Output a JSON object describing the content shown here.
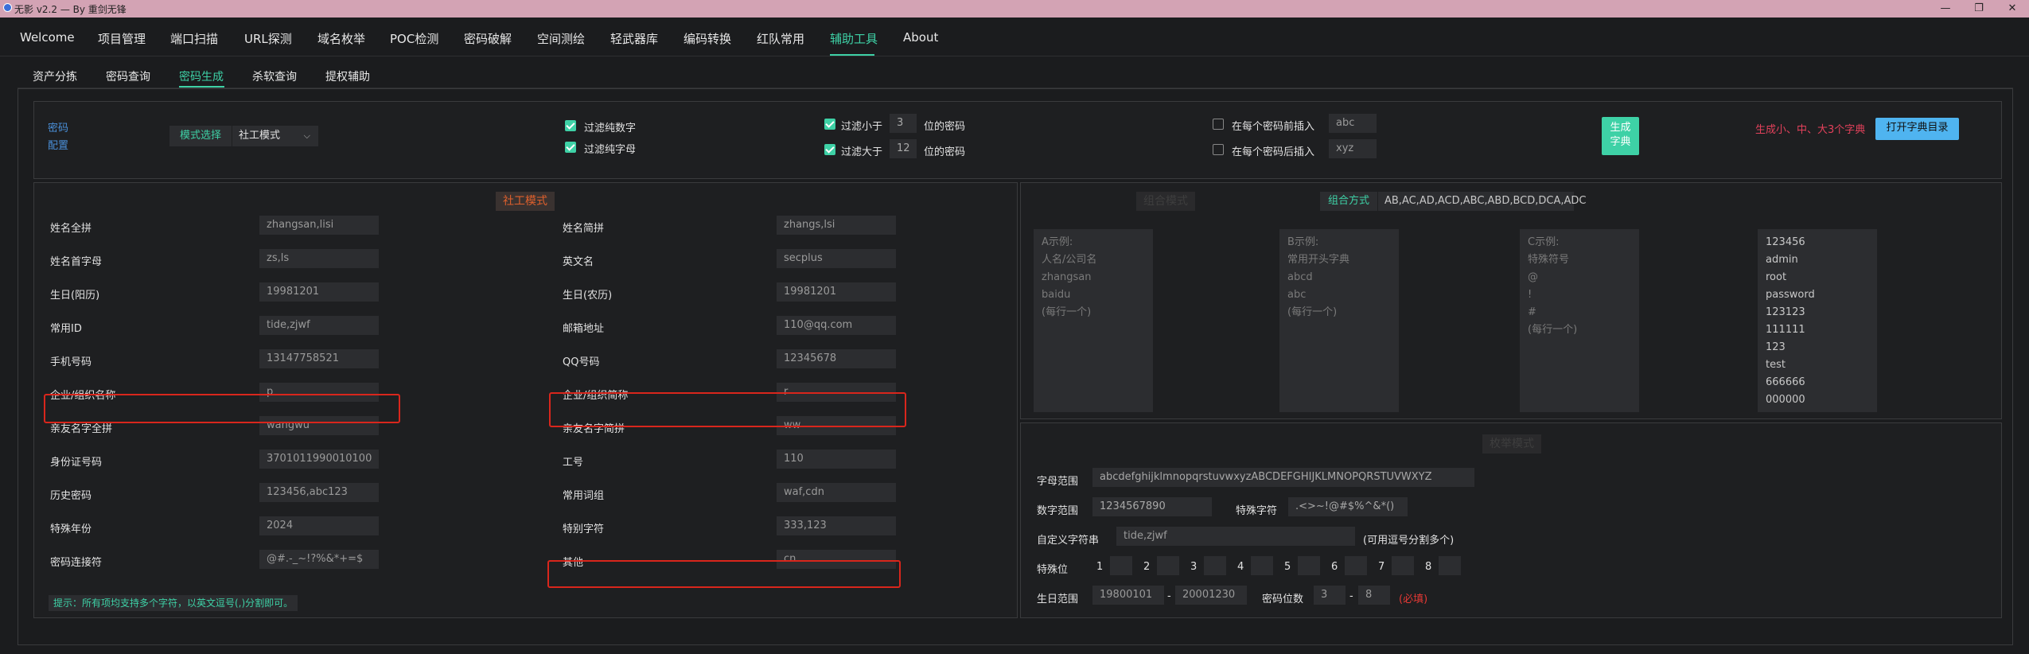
{
  "window": {
    "title": "无影 v2.2 — By 重剑无锋",
    "minimize": "—",
    "maximize": "❐",
    "close": "✕"
  },
  "menu": [
    "Welcome",
    "项目管理",
    "端口扫描",
    "URL探测",
    "域名枚举",
    "POC检测",
    "密码破解",
    "空间测绘",
    "轻武器库",
    "编码转换",
    "红队常用",
    "辅助工具",
    "About"
  ],
  "submenu": [
    "资产分拣",
    "密码查询",
    "密码生成",
    "杀软查询",
    "提权辅助"
  ],
  "config": {
    "label_line1": "密码",
    "label_line2": "配置",
    "mode_label": "模式选择",
    "mode_value": "社工模式",
    "filter_digits": "过滤纯数字",
    "filter_letters": "过滤纯字母",
    "filter_min_prefix": "过滤小于",
    "filter_min_value": "3",
    "filter_min_suffix": "位的密码",
    "filter_max_prefix": "过滤大于",
    "filter_max_value": "12",
    "filter_max_suffix": "位的密码",
    "insert_before_label": "在每个密码前插入",
    "insert_before_value": "abc",
    "insert_after_label": "在每个密码后插入",
    "insert_after_value": "xyz",
    "generate_line1": "生成",
    "generate_line2": "字典",
    "hint": "生成小、中、大3个字典",
    "open_dir": "打开字典目录"
  },
  "social": {
    "title": "社工模式",
    "left": [
      {
        "label": "姓名全拼",
        "value": "zhangsan,lisi"
      },
      {
        "label": "姓名首字母",
        "value": "zs,ls"
      },
      {
        "label": "生日(阳历)",
        "value": "19981201"
      },
      {
        "label": "常用ID",
        "value": "tide,zjwf"
      },
      {
        "label": "手机号码",
        "value": "13147758521"
      },
      {
        "label": "企业/组织名称",
        "value": "p"
      },
      {
        "label": "亲友名字全拼",
        "value": "wangwu"
      },
      {
        "label": "身份证号码",
        "value": "3701011990010100"
      },
      {
        "label": "历史密码",
        "value": "123456,abc123"
      },
      {
        "label": "特殊年份",
        "value": "2024"
      },
      {
        "label": "密码连接符",
        "value": "@#.-_~!?%&*+=$"
      }
    ],
    "right": [
      {
        "label": "姓名简拼",
        "value": "zhangs,lsi"
      },
      {
        "label": "英文名",
        "value": "secplus"
      },
      {
        "label": "生日(农历)",
        "value": "19981201"
      },
      {
        "label": "邮箱地址",
        "value": "110@qq.com"
      },
      {
        "label": "QQ号码",
        "value": "12345678"
      },
      {
        "label": "企业/组织简称",
        "value": "r"
      },
      {
        "label": "亲友名字简拼",
        "value": "ww"
      },
      {
        "label": "工号",
        "value": "110"
      },
      {
        "label": "常用词组",
        "value": "waf,cdn"
      },
      {
        "label": "特别字符",
        "value": "333,123"
      },
      {
        "label": "其他",
        "value": "cn"
      }
    ],
    "tip": "提示：所有项均支持多个字符，以英文逗号(,)分割即可。"
  },
  "combo": {
    "title": "组合模式",
    "mode_label": "组合方式",
    "mode_value": "AB,AC,AD,ACD,ABC,ABD,BCD,DCA,ADC",
    "a_text": "A示例:\n人名/公司名\nzhangsan\nbaidu\n(每行一个)",
    "b_text": "B示例:\n常用开头字典\nabcd\nabc\n(每行一个)",
    "c_text": "C示例:\n特殊符号\n@\n!\n#\n(每行一个)",
    "d_text": "123456\nadmin\nroot\npassword\n123123\n111111\n123\ntest\n666666\n000000"
  },
  "exhaust": {
    "title": "枚举模式",
    "letters_label": "字母范围",
    "letters_value": "abcdefghijklmnopqrstuvwxyzABCDEFGHIJKLMNOPQRSTUVWXYZ",
    "digits_label": "数字范围",
    "digits_value": "1234567890",
    "special_label": "特殊字符",
    "special_value": ".<>~!@#$%^&*()",
    "custom_label": "自定义字符串",
    "custom_placeholder": "tide,zjwf",
    "custom_hint": "(可用逗号分割多个)",
    "positions_label": "特殊位",
    "positions": [
      "1",
      "2",
      "3",
      "4",
      "5",
      "6",
      "7",
      "8"
    ],
    "birth_label": "生日范围",
    "birth_from": "19800101",
    "birth_dash": "-",
    "birth_to": "20001230",
    "length_label": "密码位数",
    "length_from": "3",
    "length_dash": "-",
    "length_to": "8",
    "required": "(必填)"
  }
}
